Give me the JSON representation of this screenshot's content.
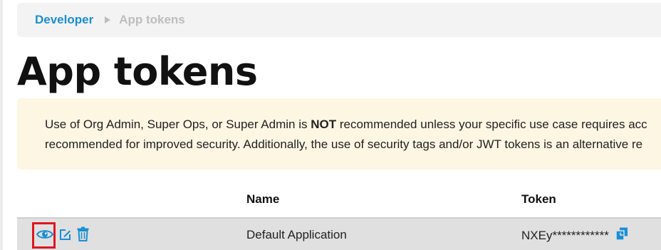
{
  "breadcrumb": {
    "parent": "Developer",
    "current": "App tokens"
  },
  "page": {
    "title": "App tokens"
  },
  "banner": {
    "line1_before": "Use of Org Admin, Super Ops, or Super Admin is ",
    "line1_bold": "NOT",
    "line1_after": " recommended unless your specific use case requires acc",
    "line2": "recommended for improved security. Additionally, the use of security tags and/or JWT tokens is an alternative re"
  },
  "table": {
    "columns": [
      "Name",
      "Token"
    ],
    "rows": [
      {
        "name": "Default Application",
        "token": "NXEy************",
        "actions": [
          "eye-icon",
          "edit-icon",
          "trash-icon"
        ]
      }
    ]
  },
  "icons": {
    "view": "eye-icon",
    "edit": "edit-icon",
    "delete": "trash-icon",
    "copy": "copy-icon"
  },
  "colors": {
    "accent": "#1a8fd6",
    "highlight": "#e0141e",
    "banner_bg": "#fdf6e3",
    "row_bg": "#e0e0e0"
  }
}
